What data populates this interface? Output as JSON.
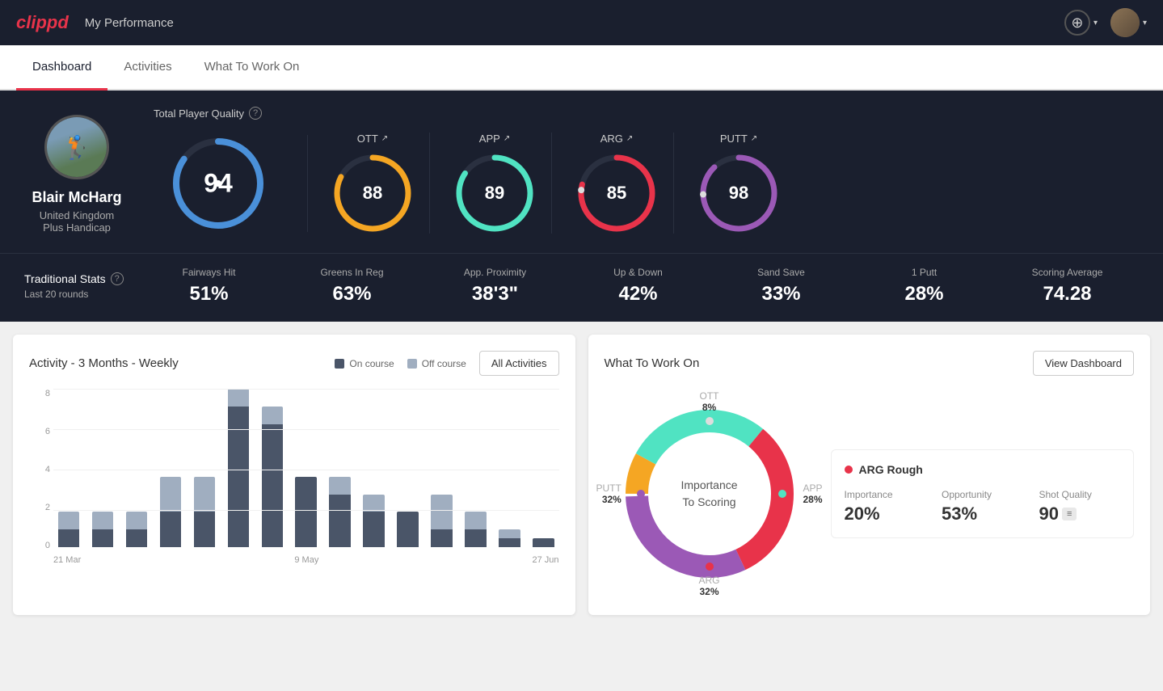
{
  "header": {
    "logo": "clippd",
    "title": "My Performance",
    "add_button_label": "+",
    "dropdown_arrow": "▾"
  },
  "tabs": [
    {
      "id": "dashboard",
      "label": "Dashboard",
      "active": true
    },
    {
      "id": "activities",
      "label": "Activities",
      "active": false
    },
    {
      "id": "what-to-work-on",
      "label": "What To Work On",
      "active": false
    }
  ],
  "player": {
    "name": "Blair McHarg",
    "country": "United Kingdom",
    "handicap": "Plus Handicap"
  },
  "total_quality": {
    "label": "Total Player Quality",
    "value": 94,
    "color": "#4a90d9"
  },
  "gauges": [
    {
      "id": "ott",
      "label": "OTT",
      "value": 88,
      "color": "#f5a623"
    },
    {
      "id": "app",
      "label": "APP",
      "value": 89,
      "color": "#50e3c2"
    },
    {
      "id": "arg",
      "label": "ARG",
      "value": 85,
      "color": "#e8334a"
    },
    {
      "id": "putt",
      "label": "PUTT",
      "value": 98,
      "color": "#9b59b6"
    }
  ],
  "traditional_stats": {
    "label": "Traditional Stats",
    "sub_label": "Last 20 rounds",
    "items": [
      {
        "name": "Fairways Hit",
        "value": "51%"
      },
      {
        "name": "Greens In Reg",
        "value": "63%"
      },
      {
        "name": "App. Proximity",
        "value": "38'3\""
      },
      {
        "name": "Up & Down",
        "value": "42%"
      },
      {
        "name": "Sand Save",
        "value": "33%"
      },
      {
        "name": "1 Putt",
        "value": "28%"
      },
      {
        "name": "Scoring Average",
        "value": "74.28"
      }
    ]
  },
  "activity_chart": {
    "title": "Activity - 3 Months - Weekly",
    "legend": [
      {
        "label": "On course",
        "color": "#4a5568"
      },
      {
        "label": "Off course",
        "color": "#a0aec0"
      }
    ],
    "all_activities_btn": "All Activities",
    "y_axis": [
      "8",
      "6",
      "4",
      "2",
      "0"
    ],
    "x_labels": [
      "21 Mar",
      "9 May",
      "27 Jun"
    ],
    "bars": [
      {
        "on": 1,
        "off": 1
      },
      {
        "on": 1,
        "off": 1
      },
      {
        "on": 1,
        "off": 1
      },
      {
        "on": 2,
        "off": 2
      },
      {
        "on": 2,
        "off": 2
      },
      {
        "on": 8,
        "off": 1
      },
      {
        "on": 7,
        "off": 1
      },
      {
        "on": 4,
        "off": 0
      },
      {
        "on": 3,
        "off": 1
      },
      {
        "on": 2,
        "off": 1
      },
      {
        "on": 2,
        "off": 0
      },
      {
        "on": 1,
        "off": 2
      },
      {
        "on": 1,
        "off": 1
      },
      {
        "on": 0.5,
        "off": 0.5
      },
      {
        "on": 0.5,
        "off": 0
      }
    ]
  },
  "what_to_work_on": {
    "title": "What To Work On",
    "view_dashboard_btn": "View Dashboard",
    "donut_center_line1": "Importance",
    "donut_center_line2": "To Scoring",
    "segments": [
      {
        "id": "ott",
        "label": "OTT",
        "percent": 8,
        "color": "#f5a623"
      },
      {
        "id": "app",
        "label": "APP",
        "percent": 28,
        "color": "#50e3c2"
      },
      {
        "id": "arg",
        "label": "ARG",
        "percent": 32,
        "color": "#e8334a"
      },
      {
        "id": "putt",
        "label": "PUTT",
        "percent": 32,
        "color": "#9b59b6"
      }
    ],
    "detail": {
      "title": "ARG Rough",
      "color": "#e8334a",
      "stats": [
        {
          "name": "Importance",
          "value": "20%"
        },
        {
          "name": "Opportunity",
          "value": "53%"
        },
        {
          "name": "Shot Quality",
          "value": "90"
        }
      ]
    }
  }
}
